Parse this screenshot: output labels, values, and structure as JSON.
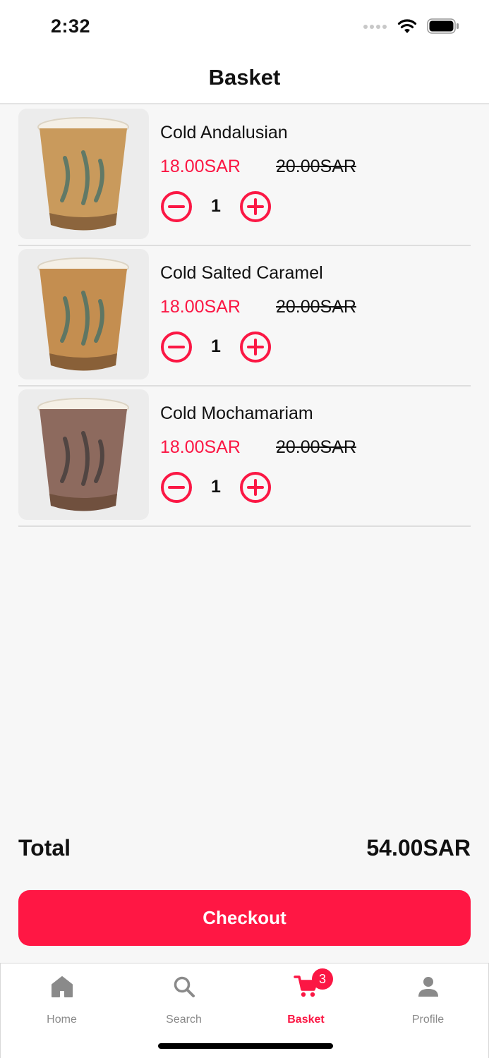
{
  "status_bar": {
    "time": "2:32"
  },
  "header": {
    "title": "Basket"
  },
  "items": [
    {
      "name": "Cold Andalusian",
      "price": "18.00SAR",
      "old_price": "20.00SAR",
      "quantity": "1",
      "drink_color": "#c99a5c"
    },
    {
      "name": "Cold Salted Caramel",
      "price": "18.00SAR",
      "old_price": "20.00SAR",
      "quantity": "1",
      "drink_color": "#c48e50"
    },
    {
      "name": "Cold Mochamariam",
      "price": "18.00SAR",
      "old_price": "20.00SAR",
      "quantity": "1",
      "drink_color": "#8d6a5e"
    }
  ],
  "summary": {
    "total_label": "Total",
    "total_value": "54.00SAR"
  },
  "checkout": {
    "label": "Checkout"
  },
  "tab_bar": {
    "tabs": [
      {
        "label": "Home",
        "icon": "home-icon"
      },
      {
        "label": "Search",
        "icon": "search-icon"
      },
      {
        "label": "Basket",
        "icon": "cart-icon",
        "badge": "3",
        "active": true
      },
      {
        "label": "Profile",
        "icon": "person-icon"
      }
    ]
  },
  "colors": {
    "accent": "#fb1744",
    "checkout_bg": "#ff1744",
    "inactive": "#8a8a8a"
  }
}
